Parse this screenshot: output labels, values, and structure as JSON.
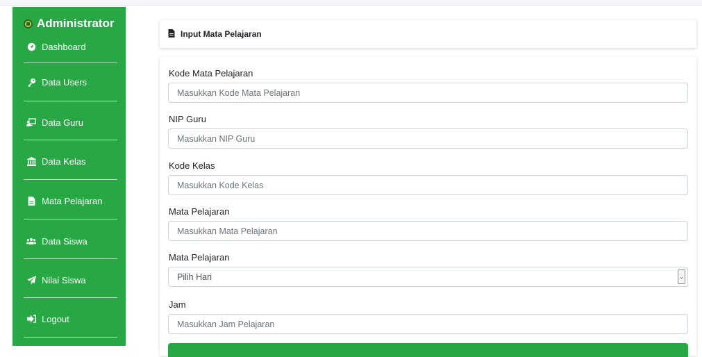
{
  "sidebar": {
    "brand": "Administrator",
    "items": [
      {
        "label": "Dashboard",
        "icon": "tachometer-icon"
      },
      {
        "label": "Data Users",
        "icon": "key-icon"
      },
      {
        "label": "Data Guru",
        "icon": "chalkboard-teacher-icon"
      },
      {
        "label": "Data Kelas",
        "icon": "university-icon"
      },
      {
        "label": "Mata Pelajaran",
        "icon": "file-icon"
      },
      {
        "label": "Data Siswa",
        "icon": "users-icon"
      },
      {
        "label": "Nilai Siswa",
        "icon": "paper-plane-icon"
      },
      {
        "label": "Logout",
        "icon": "sign-out-icon"
      }
    ]
  },
  "header": {
    "title": "Input Mata Pelajaran"
  },
  "form": {
    "kode_mapel": {
      "label": "Kode Mata Pelajaran",
      "placeholder": "Masukkan Kode Mata Pelajaran"
    },
    "nip_guru": {
      "label": "NIP Guru",
      "placeholder": "Masukkan NIP Guru"
    },
    "kode_kelas": {
      "label": "Kode Kelas",
      "placeholder": "Masukkan Kode Kelas"
    },
    "mapel": {
      "label": "Mata Pelajaran",
      "placeholder": "Masukkan Mata Pelajaran"
    },
    "hari": {
      "label": "Mata Pelajaran",
      "selected": "Pilih Hari"
    },
    "jam": {
      "label": "Jam",
      "placeholder": "Masukkan Jam Pelajaran"
    }
  },
  "colors": {
    "accent": "#28a745",
    "text": "#212529",
    "border": "#ced4da"
  }
}
